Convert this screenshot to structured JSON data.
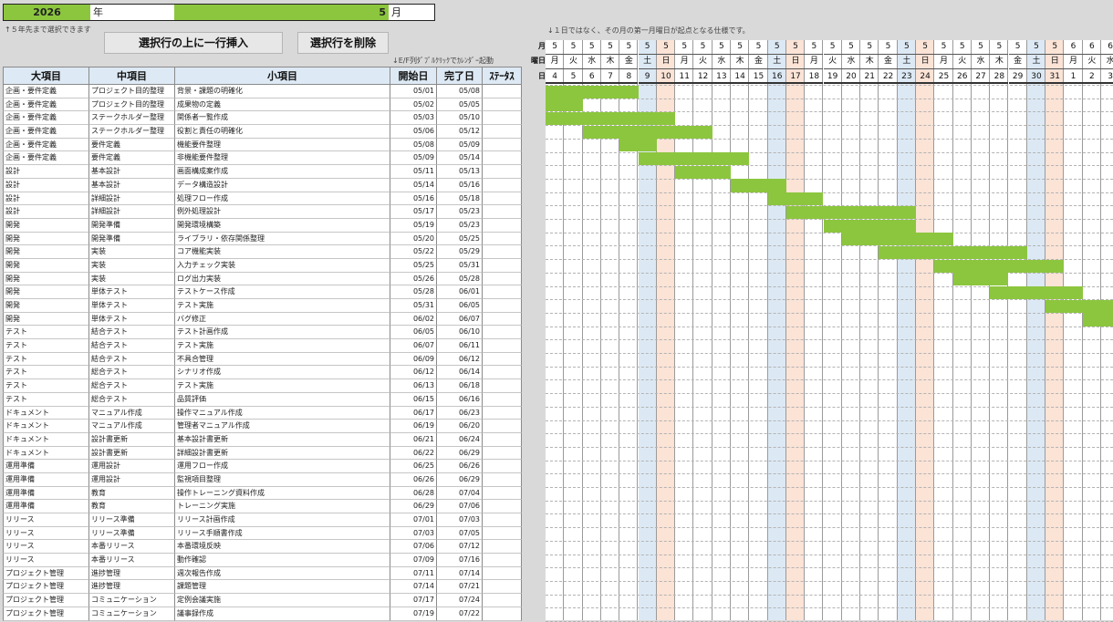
{
  "header": {
    "year": "2026",
    "year_label": "年",
    "month": "5",
    "month_label": "月",
    "note_years": "↑５年先まで選択できます",
    "note_calendar": "↓E/F列ﾀﾞﾌﾞﾙｸﾘｯｸでｶﾚﾝﾀﾞｰ起動",
    "note_start": "↓１日ではなく、その月の第一月曜日が起点となる仕様です。"
  },
  "buttons": {
    "insert": "選択行の上に一行挿入",
    "delete": "選択行を削除"
  },
  "columns": [
    "大項目",
    "中項目",
    "小項目",
    "開始日",
    "完了日",
    "ｽﾃｰﾀｽ"
  ],
  "gantt_labels": {
    "month": "月",
    "weekday": "曜日",
    "day": "日"
  },
  "colors": {
    "bar": "#8cc63e",
    "saturday": "#dce9f5",
    "sunday": "#fbe3d6"
  },
  "calendar": {
    "months": [
      "5",
      "5",
      "5",
      "5",
      "5",
      "5",
      "5",
      "5",
      "5",
      "5",
      "5",
      "5",
      "5",
      "5",
      "5",
      "5",
      "5",
      "5",
      "5",
      "5",
      "5",
      "5",
      "5",
      "5",
      "5",
      "5",
      "5",
      "5",
      "6",
      "6",
      "6"
    ],
    "weekdays": [
      "月",
      "火",
      "水",
      "木",
      "金",
      "土",
      "日",
      "月",
      "火",
      "水",
      "木",
      "金",
      "土",
      "日",
      "月",
      "火",
      "水",
      "木",
      "金",
      "土",
      "日",
      "月",
      "火",
      "水",
      "木",
      "金",
      "土",
      "日",
      "月",
      "火",
      "水"
    ],
    "days": [
      "4",
      "5",
      "6",
      "7",
      "8",
      "9",
      "10",
      "11",
      "12",
      "13",
      "14",
      "15",
      "16",
      "17",
      "18",
      "19",
      "20",
      "21",
      "22",
      "23",
      "24",
      "25",
      "26",
      "27",
      "28",
      "29",
      "30",
      "31",
      "1",
      "2",
      "3"
    ]
  },
  "tasks": [
    {
      "major": "企画・要件定義",
      "middle": "プロジェクト目的整理",
      "minor": "背景・課題の明確化",
      "start": "05/01",
      "end": "05/08",
      "status": ""
    },
    {
      "major": "企画・要件定義",
      "middle": "プロジェクト目的整理",
      "minor": "成果物の定義",
      "start": "05/02",
      "end": "05/05",
      "status": ""
    },
    {
      "major": "企画・要件定義",
      "middle": "ステークホルダー整理",
      "minor": "関係者一覧作成",
      "start": "05/03",
      "end": "05/10",
      "status": ""
    },
    {
      "major": "企画・要件定義",
      "middle": "ステークホルダー整理",
      "minor": "役割と責任の明確化",
      "start": "05/06",
      "end": "05/12",
      "status": ""
    },
    {
      "major": "企画・要件定義",
      "middle": "要件定義",
      "minor": "機能要件整理",
      "start": "05/08",
      "end": "05/09",
      "status": ""
    },
    {
      "major": "企画・要件定義",
      "middle": "要件定義",
      "minor": "非機能要件整理",
      "start": "05/09",
      "end": "05/14",
      "status": ""
    },
    {
      "major": "設計",
      "middle": "基本設計",
      "minor": "画面構成案作成",
      "start": "05/11",
      "end": "05/13",
      "status": ""
    },
    {
      "major": "設計",
      "middle": "基本設計",
      "minor": "データ構造設計",
      "start": "05/14",
      "end": "05/16",
      "status": ""
    },
    {
      "major": "設計",
      "middle": "詳細設計",
      "minor": "処理フロー作成",
      "start": "05/16",
      "end": "05/18",
      "status": ""
    },
    {
      "major": "設計",
      "middle": "詳細設計",
      "minor": "例外処理設計",
      "start": "05/17",
      "end": "05/23",
      "status": ""
    },
    {
      "major": "開発",
      "middle": "開発準備",
      "minor": "開発環境構築",
      "start": "05/19",
      "end": "05/23",
      "status": ""
    },
    {
      "major": "開発",
      "middle": "開発準備",
      "minor": "ライブラリ・依存関係整理",
      "start": "05/20",
      "end": "05/25",
      "status": ""
    },
    {
      "major": "開発",
      "middle": "実装",
      "minor": "コア機能実装",
      "start": "05/22",
      "end": "05/29",
      "status": ""
    },
    {
      "major": "開発",
      "middle": "実装",
      "minor": "入力チェック実装",
      "start": "05/25",
      "end": "05/31",
      "status": ""
    },
    {
      "major": "開発",
      "middle": "実装",
      "minor": "ログ出力実装",
      "start": "05/26",
      "end": "05/28",
      "status": ""
    },
    {
      "major": "開発",
      "middle": "単体テスト",
      "minor": "テストケース作成",
      "start": "05/28",
      "end": "06/01",
      "status": ""
    },
    {
      "major": "開発",
      "middle": "単体テスト",
      "minor": "テスト実施",
      "start": "05/31",
      "end": "06/05",
      "status": ""
    },
    {
      "major": "開発",
      "middle": "単体テスト",
      "minor": "バグ修正",
      "start": "06/02",
      "end": "06/07",
      "status": ""
    },
    {
      "major": "テスト",
      "middle": "結合テスト",
      "minor": "テスト計画作成",
      "start": "06/05",
      "end": "06/10",
      "status": ""
    },
    {
      "major": "テスト",
      "middle": "結合テスト",
      "minor": "テスト実施",
      "start": "06/07",
      "end": "06/11",
      "status": ""
    },
    {
      "major": "テスト",
      "middle": "結合テスト",
      "minor": "不具合管理",
      "start": "06/09",
      "end": "06/12",
      "status": ""
    },
    {
      "major": "テスト",
      "middle": "総合テスト",
      "minor": "シナリオ作成",
      "start": "06/12",
      "end": "06/14",
      "status": ""
    },
    {
      "major": "テスト",
      "middle": "総合テスト",
      "minor": "テスト実施",
      "start": "06/13",
      "end": "06/18",
      "status": ""
    },
    {
      "major": "テスト",
      "middle": "総合テスト",
      "minor": "品質評価",
      "start": "06/15",
      "end": "06/16",
      "status": ""
    },
    {
      "major": "ドキュメント",
      "middle": "マニュアル作成",
      "minor": "操作マニュアル作成",
      "start": "06/17",
      "end": "06/23",
      "status": ""
    },
    {
      "major": "ドキュメント",
      "middle": "マニュアル作成",
      "minor": "管理者マニュアル作成",
      "start": "06/19",
      "end": "06/20",
      "status": ""
    },
    {
      "major": "ドキュメント",
      "middle": "設計書更新",
      "minor": "基本設計書更新",
      "start": "06/21",
      "end": "06/24",
      "status": ""
    },
    {
      "major": "ドキュメント",
      "middle": "設計書更新",
      "minor": "詳細設計書更新",
      "start": "06/22",
      "end": "06/29",
      "status": ""
    },
    {
      "major": "運用準備",
      "middle": "運用設計",
      "minor": "運用フロー作成",
      "start": "06/25",
      "end": "06/26",
      "status": ""
    },
    {
      "major": "運用準備",
      "middle": "運用設計",
      "minor": "監視項目整理",
      "start": "06/26",
      "end": "06/29",
      "status": ""
    },
    {
      "major": "運用準備",
      "middle": "教育",
      "minor": "操作トレーニング資料作成",
      "start": "06/28",
      "end": "07/04",
      "status": ""
    },
    {
      "major": "運用準備",
      "middle": "教育",
      "minor": "トレーニング実施",
      "start": "06/29",
      "end": "07/06",
      "status": ""
    },
    {
      "major": "リリース",
      "middle": "リリース準備",
      "minor": "リリース計画作成",
      "start": "07/01",
      "end": "07/03",
      "status": ""
    },
    {
      "major": "リリース",
      "middle": "リリース準備",
      "minor": "リリース手順書作成",
      "start": "07/03",
      "end": "07/05",
      "status": ""
    },
    {
      "major": "リリース",
      "middle": "本番リリース",
      "minor": "本番環境反映",
      "start": "07/06",
      "end": "07/12",
      "status": ""
    },
    {
      "major": "リリース",
      "middle": "本番リリース",
      "minor": "動作確認",
      "start": "07/09",
      "end": "07/16",
      "status": ""
    },
    {
      "major": "プロジェクト管理",
      "middle": "進捗管理",
      "minor": "週次報告作成",
      "start": "07/11",
      "end": "07/14",
      "status": ""
    },
    {
      "major": "プロジェクト管理",
      "middle": "進捗管理",
      "minor": "課題管理",
      "start": "07/14",
      "end": "07/21",
      "status": ""
    },
    {
      "major": "プロジェクト管理",
      "middle": "コミュニケーション",
      "minor": "定例会議実施",
      "start": "07/17",
      "end": "07/24",
      "status": ""
    },
    {
      "major": "プロジェクト管理",
      "middle": "コミュニケーション",
      "minor": "議事録作成",
      "start": "07/19",
      "end": "07/22",
      "status": ""
    }
  ]
}
